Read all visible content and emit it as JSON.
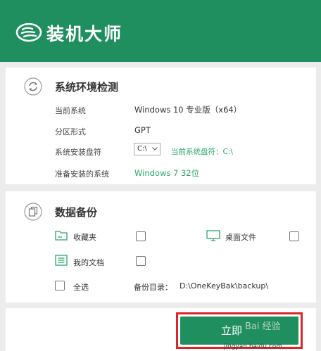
{
  "app": {
    "title": "装机大师"
  },
  "env": {
    "title": "系统环境检测",
    "rows": [
      {
        "label": "当前系统",
        "value": "Windows 10 专业版（x64）"
      },
      {
        "label": "分区形式",
        "value": "GPT"
      },
      {
        "label": "系统安装盘符",
        "drive": "C:\\",
        "drive_note": "当前系统盘符：C:\\"
      },
      {
        "label": "准备安装的系统",
        "value": "Windows 7 32位"
      }
    ]
  },
  "backup": {
    "title": "数据备份",
    "items": [
      {
        "label": "收藏夹",
        "checked": false
      },
      {
        "label": "桌面文件",
        "checked": false
      },
      {
        "label": "我的文档",
        "checked": false
      }
    ],
    "select_all": "全选",
    "dir_label": "备份目录：",
    "dir_value": "D:\\OneKeyBak\\backup\\"
  },
  "footer": {
    "start_label": "立即",
    "watermark": "Bai 经验",
    "watermark_url": "jingyan.baidu.com"
  },
  "colors": {
    "brand": "#1f8f5f",
    "accent_green": "#2aa86a",
    "highlight_red": "#d9262b"
  }
}
